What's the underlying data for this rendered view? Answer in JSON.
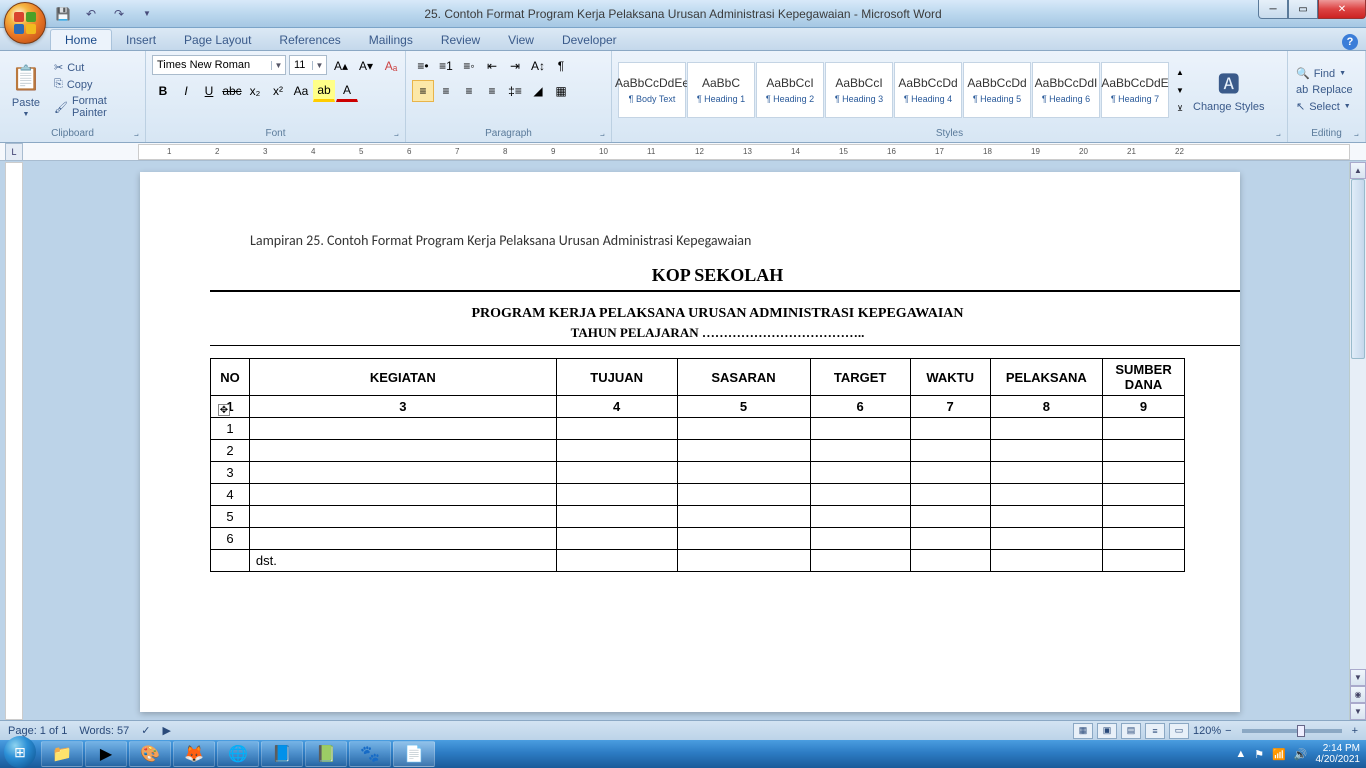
{
  "title": "25. Contoh Format Program Kerja Pelaksana Urusan Administrasi Kepegawaian - Microsoft Word",
  "tabs": {
    "home": "Home",
    "insert": "Insert",
    "pagelayout": "Page Layout",
    "references": "References",
    "mailings": "Mailings",
    "review": "Review",
    "view": "View",
    "developer": "Developer"
  },
  "clipboard": {
    "paste": "Paste",
    "cut": "Cut",
    "copy": "Copy",
    "format": "Format Painter",
    "label": "Clipboard"
  },
  "font": {
    "name": "Times New Roman",
    "size": "11",
    "label": "Font"
  },
  "paragraph": {
    "label": "Paragraph"
  },
  "styles": {
    "label": "Styles",
    "items": [
      {
        "prev": "AaBbCcDdEe",
        "name": "¶ Body Text"
      },
      {
        "prev": "AaBbC",
        "name": "¶ Heading 1"
      },
      {
        "prev": "AaBbCcI",
        "name": "¶ Heading 2"
      },
      {
        "prev": "AaBbCcI",
        "name": "¶ Heading 3"
      },
      {
        "prev": "AaBbCcDd",
        "name": "¶ Heading 4"
      },
      {
        "prev": "AaBbCcDd",
        "name": "¶ Heading 5"
      },
      {
        "prev": "AaBbCcDdI",
        "name": "¶ Heading 6"
      },
      {
        "prev": "AaBbCcDdE",
        "name": "¶ Heading 7"
      }
    ],
    "change": "Change Styles"
  },
  "editing": {
    "find": "Find",
    "replace": "Replace",
    "select": "Select",
    "label": "Editing"
  },
  "document": {
    "lampiran": "Lampiran 25. Contoh Format Program Kerja Pelaksana Urusan Administrasi Kepegawaian",
    "kop": "KOP SEKOLAH",
    "program": "PROGRAM KERJA PELAKSANA URUSAN ADMINISTRASI KEPEGAWAIAN",
    "tahun": "TAHUN  PELAJARAN  ………………………………..",
    "headers": [
      "NO",
      "KEGIATAN",
      "TUJUAN",
      "SASARAN",
      "TARGET",
      "WAKTU",
      "PELAKSANA",
      "SUMBER DANA"
    ],
    "colnums": [
      "1",
      "3",
      "4",
      "5",
      "6",
      "7",
      "8",
      "9"
    ],
    "rows": [
      "1",
      "2",
      "3",
      "4",
      "5",
      "6"
    ],
    "dst": "dst."
  },
  "status": {
    "page": "Page: 1 of 1",
    "words": "Words: 57",
    "zoom": "120%"
  },
  "tray": {
    "time": "2:14 PM",
    "date": "4/20/2021"
  }
}
